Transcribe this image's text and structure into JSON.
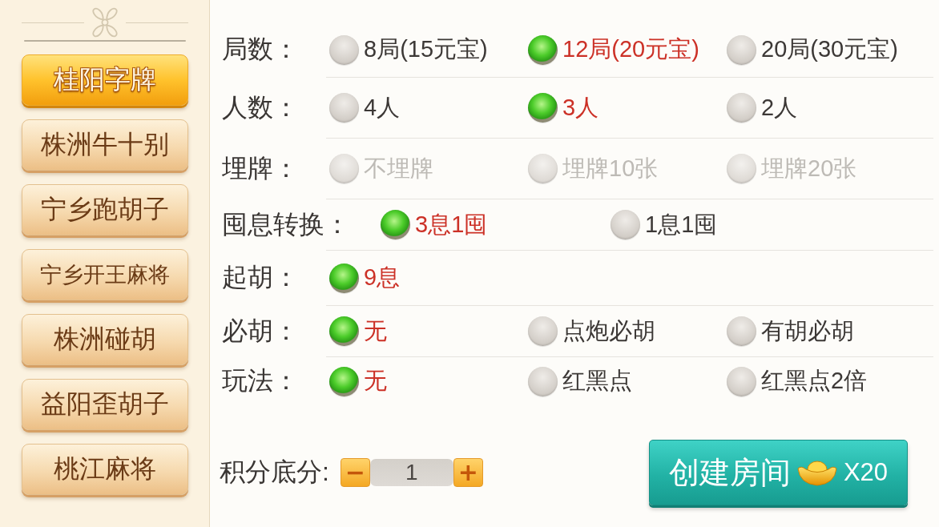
{
  "sidebar": {
    "items": [
      {
        "label": "桂阳字牌",
        "selected": true
      },
      {
        "label": "株洲牛十别",
        "selected": false
      },
      {
        "label": "宁乡跑胡子",
        "selected": false
      },
      {
        "label": "宁乡开王麻将",
        "selected": false
      },
      {
        "label": "株洲碰胡",
        "selected": false
      },
      {
        "label": "益阳歪胡子",
        "selected": false
      },
      {
        "label": "桃江麻将",
        "selected": false
      }
    ]
  },
  "options": [
    {
      "label": "局数：",
      "choices": [
        {
          "label": "8局(15元宝)",
          "selected": false,
          "disabled": false
        },
        {
          "label": "12局(20元宝)",
          "selected": true,
          "disabled": false
        },
        {
          "label": "20局(30元宝)",
          "selected": false,
          "disabled": false
        }
      ]
    },
    {
      "label": "人数：",
      "choices": [
        {
          "label": "4人",
          "selected": false,
          "disabled": false
        },
        {
          "label": "3人",
          "selected": true,
          "disabled": false
        },
        {
          "label": "2人",
          "selected": false,
          "disabled": false
        }
      ]
    },
    {
      "label": "埋牌：",
      "choices": [
        {
          "label": "不埋牌",
          "selected": false,
          "disabled": true
        },
        {
          "label": "埋牌10张",
          "selected": false,
          "disabled": true
        },
        {
          "label": "埋牌20张",
          "selected": false,
          "disabled": true
        }
      ]
    },
    {
      "label": "囤息转换：",
      "choices": [
        {
          "label": "3息1囤",
          "selected": true,
          "disabled": false
        },
        {
          "label": "1息1囤",
          "selected": false,
          "disabled": false
        }
      ]
    },
    {
      "label": "起胡：",
      "choices": [
        {
          "label": "9息",
          "selected": true,
          "disabled": false
        }
      ]
    },
    {
      "label": "必胡：",
      "choices": [
        {
          "label": "无",
          "selected": true,
          "disabled": false
        },
        {
          "label": "点炮必胡",
          "selected": false,
          "disabled": false
        },
        {
          "label": "有胡必胡",
          "selected": false,
          "disabled": false
        }
      ]
    },
    {
      "label": "玩法：",
      "choices": [
        {
          "label": "无",
          "selected": true,
          "disabled": false
        },
        {
          "label": "红黑点",
          "selected": false,
          "disabled": false
        },
        {
          "label": "红黑点2倍",
          "selected": false,
          "disabled": false
        }
      ]
    }
  ],
  "base_score": {
    "label": "积分底分:",
    "decrement": "−",
    "value": "1",
    "increment": "+"
  },
  "create_button": {
    "label": "创建房间",
    "cost": "X20"
  }
}
